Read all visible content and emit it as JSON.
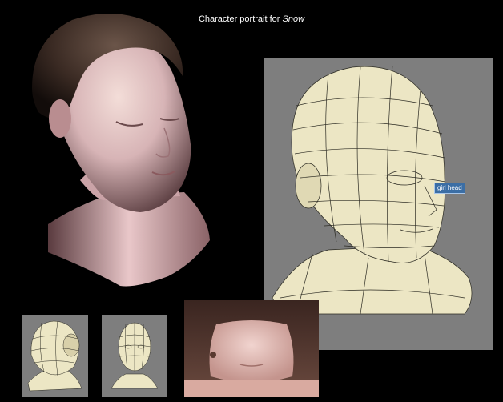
{
  "title": {
    "prefix": "Character portrait for ",
    "subject": "Snow"
  },
  "wire_panel": {
    "tag_label": "girl head",
    "background": "#7e7e7e",
    "mesh_color": "#ece6c4",
    "line_color": "#2b2a22"
  },
  "images": [
    {
      "name": "shaded-head-render"
    },
    {
      "name": "wireframe-head-large"
    },
    {
      "name": "wireframe-head-side-thumb"
    },
    {
      "name": "wireframe-head-front-thumb"
    },
    {
      "name": "unwrapped-texture-thumb"
    }
  ]
}
